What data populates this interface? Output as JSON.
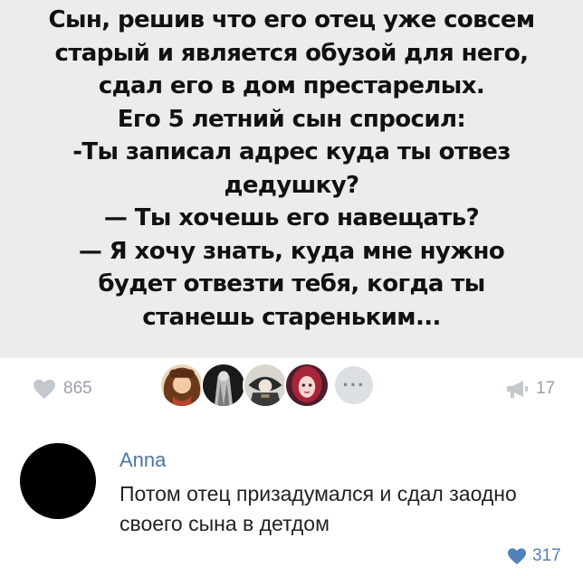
{
  "post": {
    "text_lines": [
      "Сын, решив что его отец уже совсем",
      "старый и является обузой для него,",
      "сдал его в дом престарелых.",
      "Его 5 летний сын спросил:",
      "-Ты записал адрес куда ты отвез",
      "дедушку?",
      "— Ты хочешь его навещать?",
      "— Я хочу знать, куда мне нужно",
      "будет отвезти тебя, когда ты",
      "станешь стареньким..."
    ]
  },
  "actions": {
    "like_icon": "heart-icon",
    "like_count": "865",
    "more_label": "···",
    "share_icon": "megaphone-icon",
    "share_count": "17"
  },
  "comment": {
    "author": "Anna",
    "text": "Потом отец призадумался и сдал заодно своего сына в детдом",
    "like_icon": "heart-icon",
    "like_count": "317"
  },
  "colors": {
    "image_bg": "#ececec",
    "muted_gray": "#9aa0a6",
    "link_blue": "#4a76a8",
    "like_blue": "#5181b8"
  }
}
